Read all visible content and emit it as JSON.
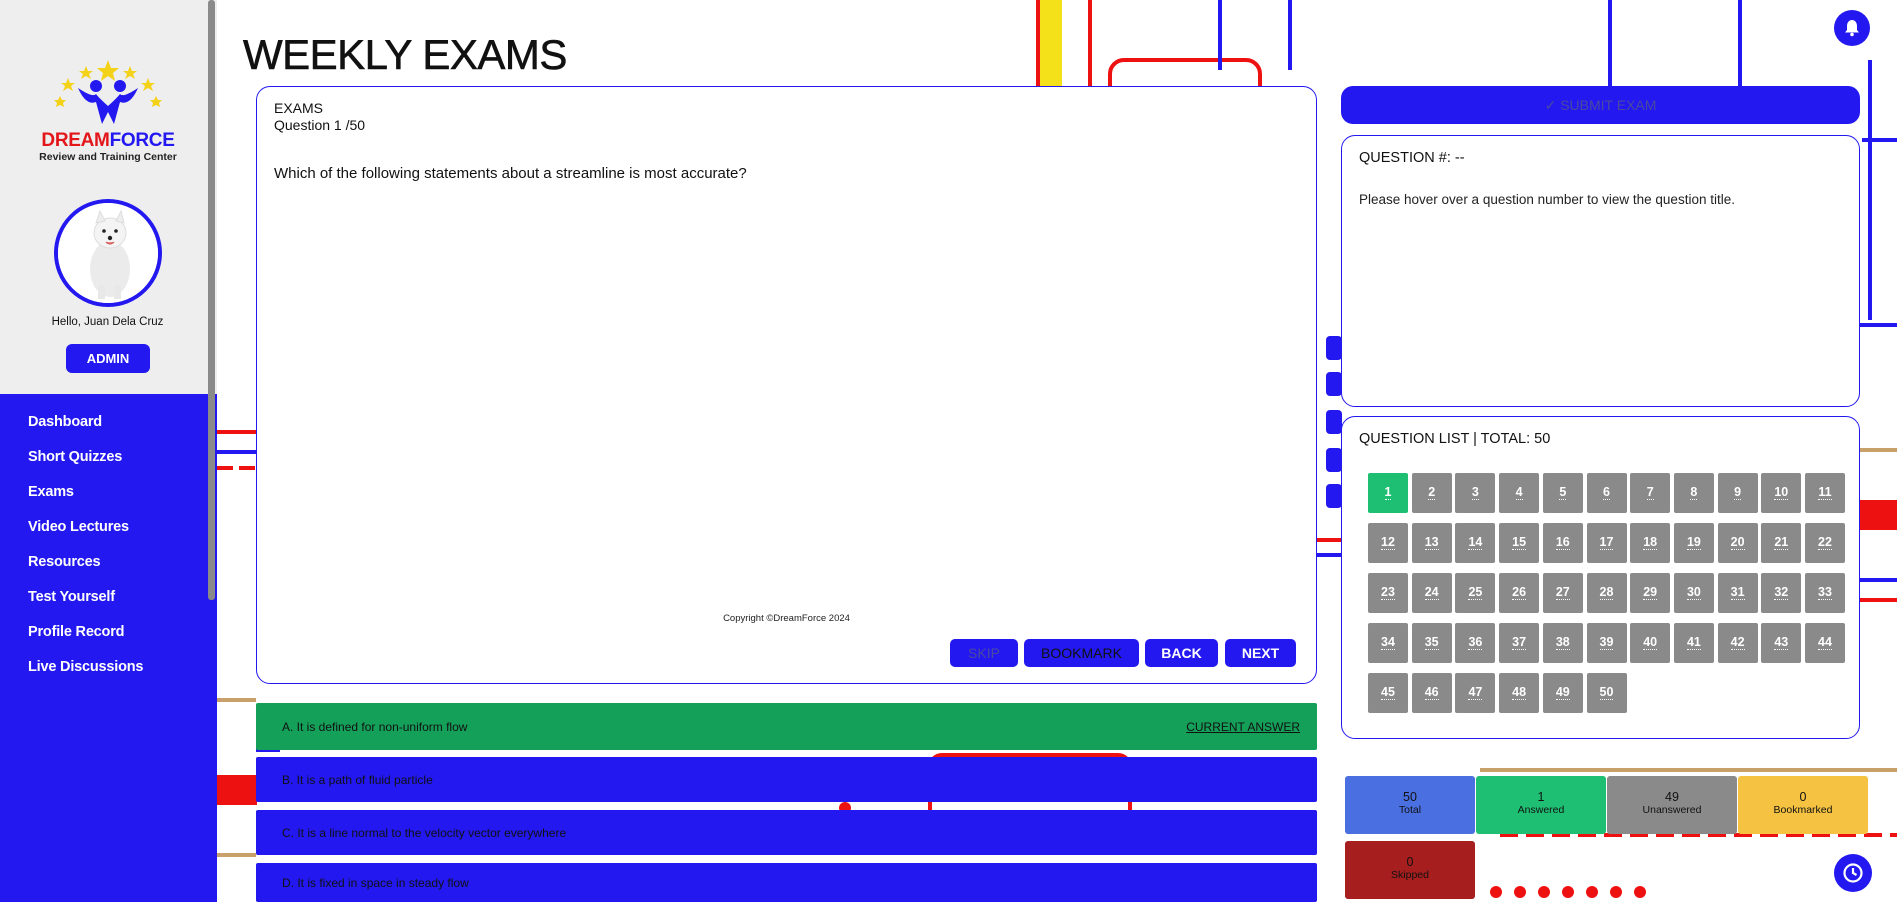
{
  "app": {
    "brand_part1": "DREAM",
    "brand_part2": "FORCE",
    "brand_sub": "Review and Training Center",
    "page_title": "WEEKLY EXAMS",
    "copyright": "Copyright ©DreamForce 2024"
  },
  "user": {
    "greeting": "Hello, Juan Dela Cruz",
    "role_button": "ADMIN"
  },
  "nav": [
    {
      "label": "Dashboard"
    },
    {
      "label": "Short Quizzes"
    },
    {
      "label": "Exams"
    },
    {
      "label": "Video Lectures"
    },
    {
      "label": "Resources"
    },
    {
      "label": "Test Yourself"
    },
    {
      "label": "Profile Record"
    },
    {
      "label": "Live Discussions"
    }
  ],
  "question": {
    "section": "EXAMS",
    "counter": "Question 1 /50",
    "text": "Which of the following statements about a streamline is most accurate?",
    "buttons": {
      "skip": "SKIP",
      "bookmark": "BOOKMARK",
      "back": "BACK",
      "next": "NEXT"
    }
  },
  "options": [
    {
      "label": "A. It is defined for non-uniform flow",
      "state": "selected"
    },
    {
      "label": "B. It is a path of fluid particle",
      "state": "default"
    },
    {
      "label": "C. It is a line normal to the velocity vector everywhere",
      "state": "default"
    },
    {
      "label": "D. It is fixed in space in steady flow",
      "state": "default"
    }
  ],
  "current_answer_label": "CURRENT ANSWER",
  "submit": {
    "label": "✓ SUBMIT EXAM"
  },
  "preview": {
    "title": "QUESTION #: --",
    "hint": "Please hover over a question number to view the question title."
  },
  "question_list": {
    "title": "QUESTION LIST | TOTAL: 50",
    "total": 50,
    "current": 1,
    "numbers": [
      "1",
      "2",
      "3",
      "4",
      "5",
      "6",
      "7",
      "8",
      "9",
      "10",
      "11",
      "12",
      "13",
      "14",
      "15",
      "16",
      "17",
      "18",
      "19",
      "20",
      "21",
      "22",
      "23",
      "24",
      "25",
      "26",
      "27",
      "28",
      "29",
      "30",
      "31",
      "32",
      "33",
      "34",
      "35",
      "36",
      "37",
      "38",
      "39",
      "40",
      "41",
      "42",
      "43",
      "44",
      "45",
      "46",
      "47",
      "48",
      "49",
      "50"
    ]
  },
  "stats": {
    "total": {
      "value": "50",
      "label": "Total"
    },
    "answered": {
      "value": "1",
      "label": "Answered"
    },
    "unanswered": {
      "value": "49",
      "label": "Unanswered"
    },
    "bookmarked": {
      "value": "0",
      "label": "Bookmarked"
    },
    "skipped": {
      "value": "0",
      "label": "Skipped"
    }
  },
  "colors": {
    "accent": "#2318f0",
    "answered": "#1fbf73",
    "selected_option": "#15a05a",
    "unanswered": "#8a8a8a",
    "bookmarked": "#f5c242",
    "skipped": "#a61e1e",
    "total": "#4a6fe0"
  },
  "icons": {
    "notification": "bell-icon",
    "timer": "clock-icon",
    "logo": "dreamforce-stars-logo",
    "avatar": "samoyed-dog-photo"
  }
}
